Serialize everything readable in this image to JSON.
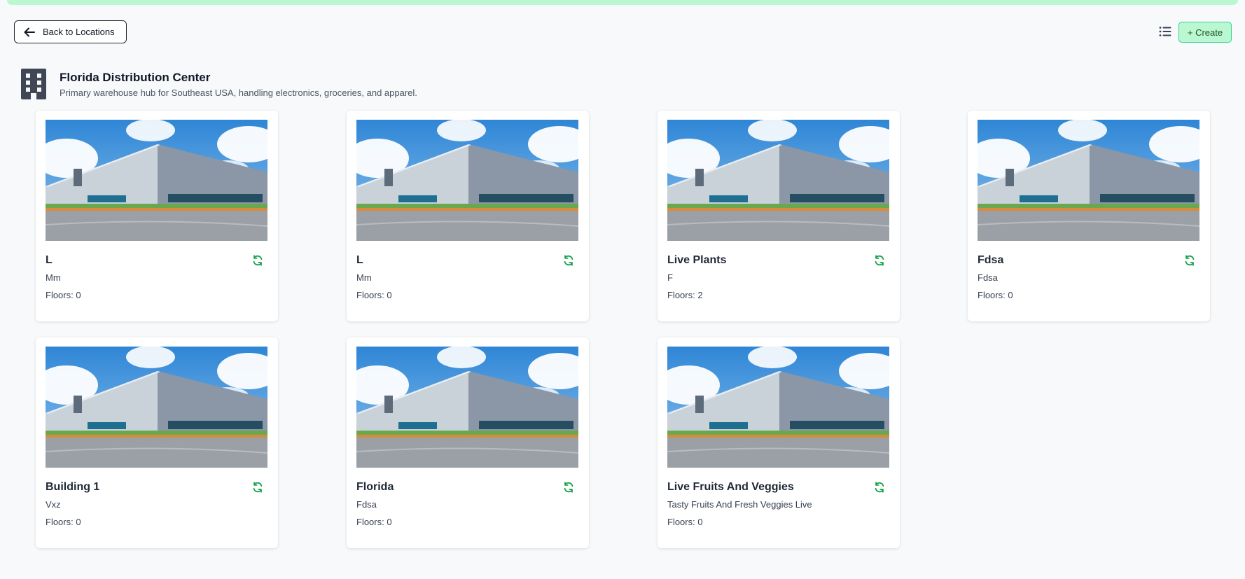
{
  "header": {
    "back_label": "Back to Locations",
    "create_label": "+ Create"
  },
  "location": {
    "title": "Florida Distribution Center",
    "description": "Primary warehouse hub for Southeast USA, handling electronics, groceries, and apparel."
  },
  "colors": {
    "accent": "#16a34a",
    "create_bg": "#bbf7d0",
    "topbar": "#bbf7d0"
  },
  "buildings": [
    {
      "name": "L",
      "subtitle": "Mm",
      "floors": "Floors: 0"
    },
    {
      "name": "L",
      "subtitle": "Mm",
      "floors": "Floors: 0"
    },
    {
      "name": "Live Plants",
      "subtitle": "F",
      "floors": "Floors: 2"
    },
    {
      "name": "Fdsa",
      "subtitle": "Fdsa",
      "floors": "Floors: 0"
    },
    {
      "name": "Building 1",
      "subtitle": "Vxz",
      "floors": "Floors: 0"
    },
    {
      "name": "Florida",
      "subtitle": "Fdsa",
      "floors": "Floors: 0"
    },
    {
      "name": "Live Fruits And Veggies",
      "subtitle": "Tasty Fruits And Fresh Veggies Live",
      "floors": "Floors: 0"
    }
  ]
}
